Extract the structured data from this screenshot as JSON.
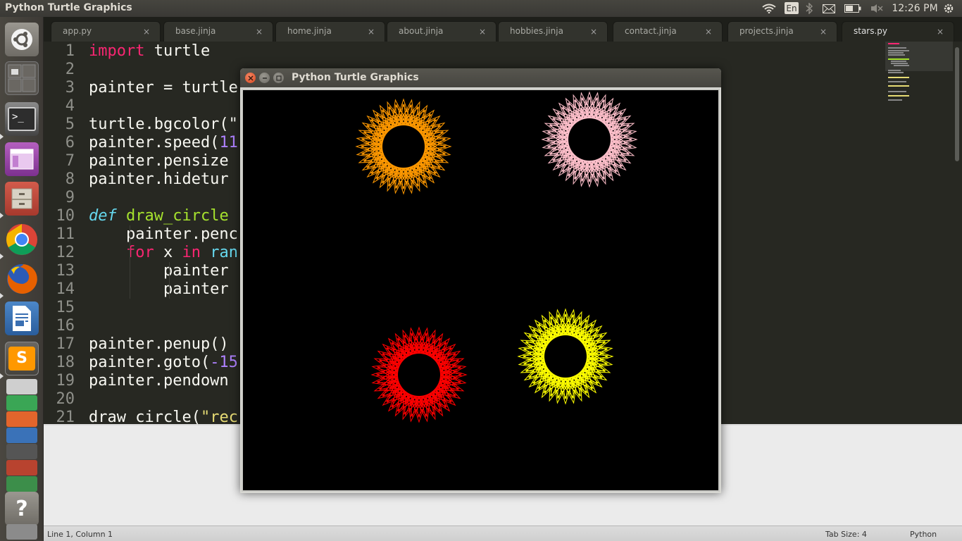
{
  "top_panel": {
    "title": "Python Turtle Graphics",
    "keyboard_layout": "En",
    "clock": "12:26 PM",
    "icons": [
      "wifi-icon",
      "keyboard-icon",
      "bluetooth-icon",
      "mail-icon",
      "battery-icon",
      "volume-mute-icon",
      "gear-icon"
    ]
  },
  "launcher": {
    "items": [
      {
        "name": "ubuntu-dash",
        "icon": "ubuntu-logo-icon"
      },
      {
        "name": "workspace-switcher",
        "icon": "workspaces-icon"
      },
      {
        "name": "terminal",
        "icon": "terminal-icon",
        "glyph": ">_"
      },
      {
        "name": "window",
        "icon": "window-icon"
      },
      {
        "name": "file-manager",
        "icon": "file-cabinet-icon"
      },
      {
        "name": "chrome",
        "icon": "chrome-icon"
      },
      {
        "name": "firefox",
        "icon": "firefox-icon"
      },
      {
        "name": "writer",
        "icon": "document-icon"
      },
      {
        "name": "sublime-text",
        "icon": "sublime-icon",
        "glyph": "S"
      },
      {
        "name": "help",
        "icon": "help-icon",
        "glyph": "?"
      }
    ]
  },
  "editor": {
    "tabs": [
      {
        "label": "app.py",
        "active": false
      },
      {
        "label": "base.jinja",
        "active": false
      },
      {
        "label": "home.jinja",
        "active": false
      },
      {
        "label": "about.jinja",
        "active": false
      },
      {
        "label": "hobbies.jinja",
        "active": false
      },
      {
        "label": "contact.jinja",
        "active": false
      },
      {
        "label": "projects.jinja",
        "active": false
      },
      {
        "label": "stars.py",
        "active": true
      }
    ],
    "close_glyph": "×",
    "line_numbers": [
      "1",
      "2",
      "3",
      "4",
      "5",
      "6",
      "7",
      "8",
      "9",
      "10",
      "11",
      "12",
      "13",
      "14",
      "15",
      "16",
      "17",
      "18",
      "19",
      "20",
      "21"
    ],
    "lines": {
      "l1_kw": "import",
      "l1_rest": " turtle",
      "l3": "painter = turtle",
      "l5": "turtle.bgcolor(\"",
      "l6_a": "painter.speed(",
      "l6_num": "11",
      "l7": "painter.pensize",
      "l8": "painter.hidetur",
      "l10_def": "def",
      "l10_fn": " draw_circle",
      "l11": "    painter.penc",
      "l12_kw": "    for",
      "l12_mid": " x ",
      "l12_in": "in",
      "l12_bi": " ran",
      "l13": "        painter",
      "l14": "        painter",
      "l17": "painter.penup()",
      "l18_a": "painter.goto(",
      "l18_num": "-15",
      "l19": "painter.pendown",
      "l21_a": "draw_circle(",
      "l21_str": "\"rec"
    }
  },
  "status_bar": {
    "position": "Line 1, Column 1",
    "tab_size": "Tab Size: 4",
    "syntax": "Python"
  },
  "turtle_window": {
    "title": "Python Turtle Graphics",
    "background": "#000000",
    "spirographs": [
      {
        "color": "#ff9900",
        "name": "orange"
      },
      {
        "color": "#ffc0cb",
        "name": "pink"
      },
      {
        "color": "#ff0000",
        "name": "red"
      },
      {
        "color": "#ffff00",
        "name": "yellow"
      }
    ]
  }
}
